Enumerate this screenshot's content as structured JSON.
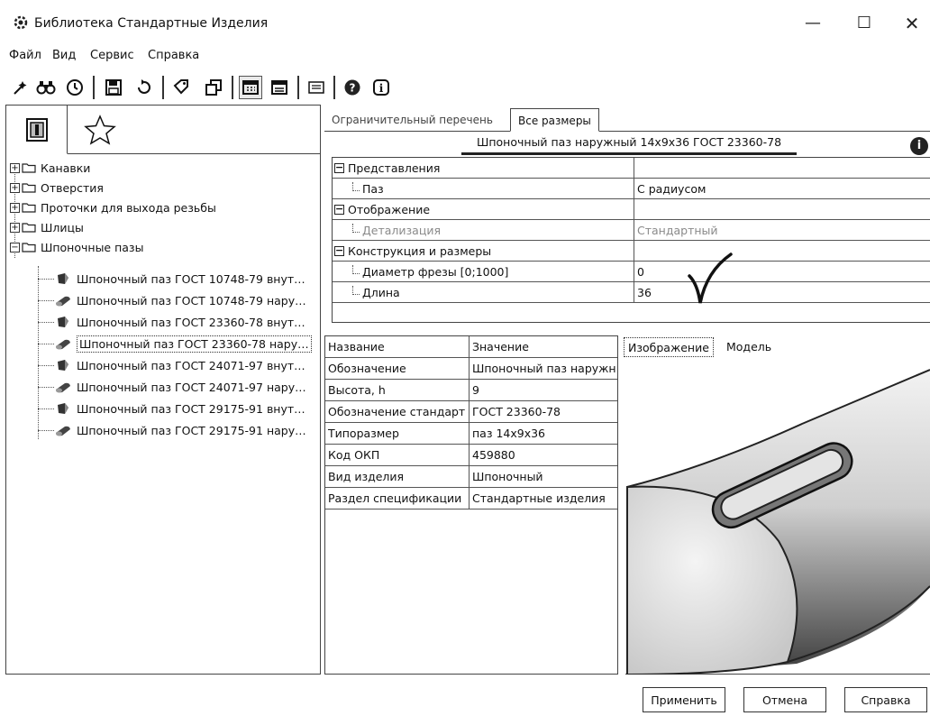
{
  "window": {
    "title": "Библиотека Стандартные Изделия",
    "minimize": "—",
    "maximize": "☐",
    "close": "✕"
  },
  "menu": [
    "Файл",
    "Вид",
    "Сервис",
    "Справка"
  ],
  "toolbar": {
    "icons": [
      "wizard-icon",
      "binoculars-icon",
      "clock-icon",
      "save-icon",
      "refresh-icon",
      "tag-icon",
      "copy-icon",
      "table-view-icon",
      "list-view-icon",
      "detail-view-icon",
      "help-icon",
      "info-icon"
    ],
    "pressed": "table-view-icon"
  },
  "left_tabs": [
    "catalog-icon",
    "favorites-star-icon"
  ],
  "tree": {
    "folders": [
      {
        "label": "Канавки",
        "expanded": false
      },
      {
        "label": "Отверстия",
        "expanded": false
      },
      {
        "label": "Проточки для выхода резьбы",
        "expanded": false
      },
      {
        "label": "Шлицы",
        "expanded": false
      },
      {
        "label": "Шпоночные пазы",
        "expanded": true
      }
    ],
    "children": [
      {
        "label": "Шпоночный паз ГОСТ 10748-79 внут…",
        "kind": "inner"
      },
      {
        "label": "Шпоночный паз ГОСТ 10748-79 нару…",
        "kind": "outer"
      },
      {
        "label": "Шпоночный паз ГОСТ 23360-78 внут…",
        "kind": "inner"
      },
      {
        "label": "Шпоночный паз ГОСТ 23360-78 нару…",
        "kind": "outer",
        "selected": true
      },
      {
        "label": "Шпоночный паз ГОСТ 24071-97 внут…",
        "kind": "inner"
      },
      {
        "label": "Шпоночный паз ГОСТ 24071-97 нару…",
        "kind": "outer"
      },
      {
        "label": "Шпоночный паз ГОСТ 29175-91 внут…",
        "kind": "inner"
      },
      {
        "label": "Шпоночный паз ГОСТ 29175-91 нару…",
        "kind": "outer"
      }
    ]
  },
  "right_tabs": [
    "Ограничительный перечень",
    "Все размеры"
  ],
  "active_right_tab": "Все размеры",
  "property_title": "Шпоночный паз наружный 14х9х36 ГОСТ 23360-78",
  "info_glyph": "i",
  "property_grid": [
    {
      "group": "Представления"
    },
    {
      "name": "Паз",
      "value": "С радиусом"
    },
    {
      "group": "Отображение"
    },
    {
      "name": "Детализация",
      "value": "Стандартный",
      "disabled": true
    },
    {
      "group": "Конструкция и размеры"
    },
    {
      "name": "Диаметр фрезы [0;1000]",
      "value": "0"
    },
    {
      "name": "Длина",
      "value": "36"
    }
  ],
  "params_table": {
    "headers": [
      "Название",
      "Значение"
    ],
    "rows": [
      [
        "Обозначение",
        "Шпоночный паз наружн"
      ],
      [
        "Высота, h",
        "9"
      ],
      [
        "Обозначение стандарт",
        "ГОСТ 23360-78"
      ],
      [
        "Типоразмер",
        "паз 14х9х36"
      ],
      [
        "Код ОКП",
        "459880"
      ],
      [
        "Вид изделия",
        "Шпоночный"
      ],
      [
        "Раздел спецификации",
        "Стандартные изделия"
      ]
    ]
  },
  "preview_tabs": [
    "Изображение",
    "Модель"
  ],
  "buttons": {
    "apply": "Применить",
    "cancel": "Отмена",
    "help": "Справка"
  }
}
